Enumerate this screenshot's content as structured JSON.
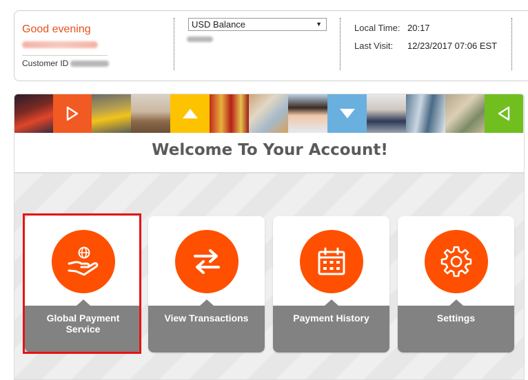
{
  "header": {
    "greeting": "Good evening",
    "customer_id_label": "Customer ID",
    "balance_select": {
      "selected": "USD Balance"
    },
    "local_time_label": "Local Time:",
    "local_time_value": "20:17",
    "last_visit_label": "Last Visit:",
    "last_visit_value": "12/23/2017 07:06 EST"
  },
  "main": {
    "welcome_title": "Welcome To Your Account!",
    "cards": [
      {
        "label": "Global Payment Service",
        "icon": "globe-hand-icon"
      },
      {
        "label": "View Transactions",
        "icon": "swap-arrows-icon"
      },
      {
        "label": "Payment History",
        "icon": "calendar-icon"
      },
      {
        "label": "Settings",
        "icon": "gear-icon"
      }
    ],
    "highlighted_card": "Global Payment Service"
  },
  "colors": {
    "accent": "#fe5000",
    "greeting": "#e8501a",
    "card_label_bg": "#828282",
    "highlight_border": "#e41414",
    "banner_orange": "#f15a22",
    "banner_yellow": "#fdc300",
    "banner_blue": "#6ab0de",
    "banner_green": "#70bf1f"
  }
}
